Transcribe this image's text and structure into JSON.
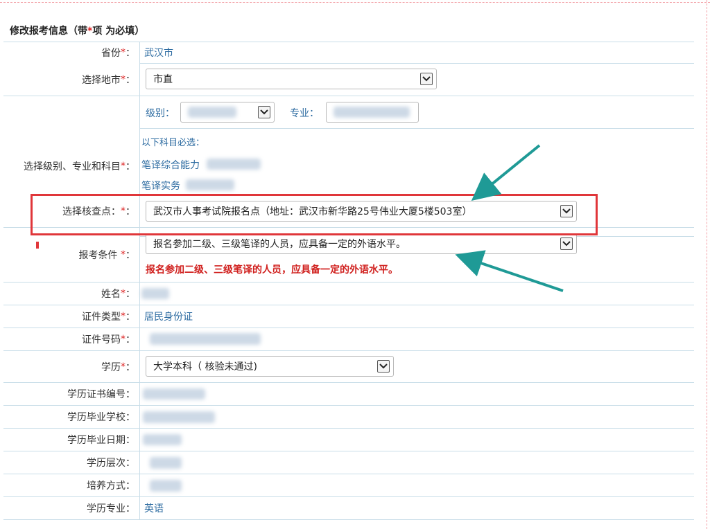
{
  "title": {
    "text": "修改报考信息（带",
    "star": "*",
    "rest": "项 为必填）"
  },
  "required_mark": "*",
  "province": {
    "label": "省份",
    "value": "武汉市"
  },
  "city": {
    "label": "选择地市",
    "selected": "市直"
  },
  "level_major": {
    "label": "选择级别、专业和科目",
    "level_label": "级别：",
    "major_label": "专业：",
    "subjects_note": "以下科目必选：",
    "subject_1": "笔译综合能力",
    "subject_2": "笔译实务"
  },
  "checkpoint": {
    "label": "选择核查点：",
    "selected": "武汉市人事考试院报名点（地址：武汉市新华路25号伟业大厦5楼503室）"
  },
  "condition": {
    "label": "报考条件",
    "selected": "报名参加二级、三级笔译的人员，应具备一定的外语水平。",
    "note": "报名参加二级、三级笔译的人员，应具备一定的外语水平。"
  },
  "name": {
    "label": "姓名"
  },
  "id_type": {
    "label": "证件类型",
    "value": "居民身份证"
  },
  "id_number": {
    "label": "证件号码"
  },
  "education": {
    "label": "学历",
    "selected": "大学本科（ 核验未通过)"
  },
  "cert_no": {
    "label": "学历证书编号："
  },
  "school": {
    "label": "学历毕业学校："
  },
  "grad_date": {
    "label": "学历毕业日期："
  },
  "edu_level": {
    "label": "学历层次："
  },
  "training": {
    "label": "培养方式："
  },
  "edu_major": {
    "label": "学历专业：",
    "value": "英语"
  },
  "colors": {
    "accent": "#2b6aa0",
    "required": "#d22222",
    "highlight": "#e0363a",
    "arrow": "#1f9a96"
  }
}
